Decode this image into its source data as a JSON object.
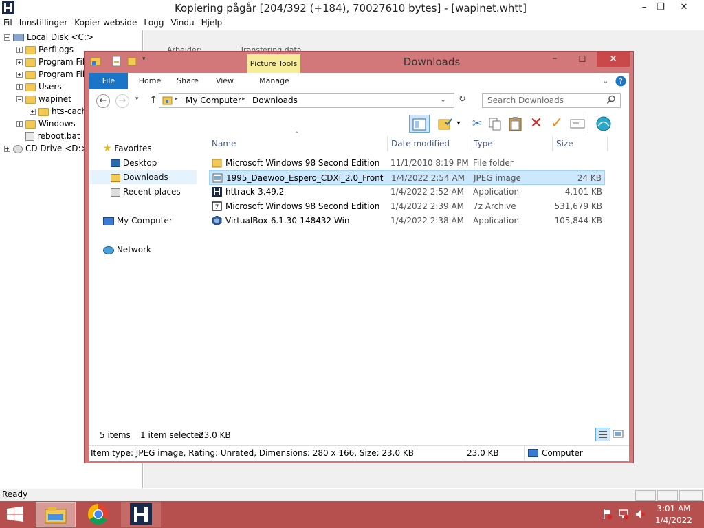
{
  "app": {
    "title": "Kopiering pågår [204/392 (+184), 70027610 bytes] - [wapinet.whtt]",
    "minimize": "–",
    "maximize": "❐",
    "close": "✕",
    "menu": [
      "Fil",
      "Innstillinger",
      "Kopier webside",
      "Logg",
      "Vindu",
      "Hjelp"
    ],
    "status": "Ready"
  },
  "tree": [
    {
      "label": "Local Disk <C:>",
      "kind": "drive",
      "toggle": "−"
    },
    {
      "label": "PerfLogs",
      "kind": "folder",
      "toggle": "+"
    },
    {
      "label": "Program Fil",
      "kind": "folder",
      "toggle": "+"
    },
    {
      "label": "Program Fil",
      "kind": "folder",
      "toggle": "+"
    },
    {
      "label": "Users",
      "kind": "folder",
      "toggle": "+"
    },
    {
      "label": "wapinet",
      "kind": "folder",
      "toggle": "−"
    },
    {
      "label": "hts-cach",
      "kind": "folder",
      "toggle": "+"
    },
    {
      "label": "Windows",
      "kind": "folder",
      "toggle": "+"
    },
    {
      "label": "reboot.bat",
      "kind": "file",
      "toggle": ""
    },
    {
      "label": "CD Drive <D:>",
      "kind": "cd",
      "toggle": "+"
    }
  ],
  "explorer": {
    "title": "Downloads",
    "picture_tools": "Picture Tools",
    "tabs": [
      "File",
      "Home",
      "Share",
      "View",
      "Manage"
    ],
    "address": [
      "My Computer",
      "Downloads"
    ],
    "search_placeholder": "Search Downloads",
    "columns": [
      "Name",
      "Date modified",
      "Type",
      "Size"
    ],
    "nav": {
      "favorites": "Favorites",
      "desktop": "Desktop",
      "downloads": "Downloads",
      "recent": "Recent places",
      "computer": "My Computer",
      "network": "Network"
    },
    "files": [
      {
        "name": "Microsoft Windows 98 Second Edition",
        "date": "11/1/2010 8:19 PM",
        "type": "File folder",
        "size": "",
        "icon": "folder-icon",
        "selected": false
      },
      {
        "name": "1995_Daewoo_Espero_CDXi_2.0_Front",
        "date": "1/4/2022 2:54 AM",
        "type": "JPEG image",
        "size": "24 KB",
        "icon": "image-icon",
        "selected": true
      },
      {
        "name": "httrack-3.49.2",
        "date": "1/4/2022 2:52 AM",
        "type": "Application",
        "size": "4,101 KB",
        "icon": "httrack-icon",
        "selected": false
      },
      {
        "name": "Microsoft Windows 98 Second Edition",
        "date": "1/4/2022 2:39 AM",
        "type": "7z Archive",
        "size": "531,679 KB",
        "icon": "archive-icon",
        "selected": false
      },
      {
        "name": "VirtualBox-6.1.30-148432-Win",
        "date": "1/4/2022 2:38 AM",
        "type": "Application",
        "size": "105,844 KB",
        "icon": "virtualbox-icon",
        "selected": false
      }
    ],
    "status_items": "5 items",
    "status_selected": "1 item selected",
    "status_size": "23.0 KB",
    "details_text": "Item type: JPEG image, Rating: Unrated, Dimensions: 280 x 166, Size: 23.0 KB",
    "details_size": "23.0 KB",
    "details_location": "Computer"
  },
  "right_pane_fragments": [
    "Arbeider:",
    "Transfering data..."
  ],
  "taskbar": {
    "time": "3:01 AM",
    "date": "1/4/2022"
  }
}
